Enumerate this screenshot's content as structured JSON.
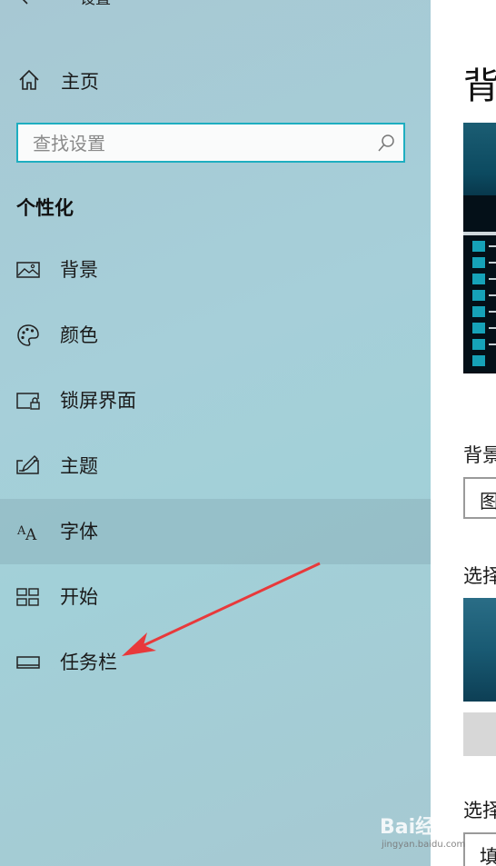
{
  "app": {
    "title": "设置"
  },
  "sidebar": {
    "home_label": "主页",
    "search_placeholder": "查找设置",
    "section_title": "个性化",
    "items": [
      {
        "label": "背景",
        "icon": "picture-icon"
      },
      {
        "label": "颜色",
        "icon": "palette-icon"
      },
      {
        "label": "锁屏界面",
        "icon": "lock-screen-icon"
      },
      {
        "label": "主题",
        "icon": "theme-icon"
      },
      {
        "label": "字体",
        "icon": "font-icon",
        "selected": true
      },
      {
        "label": "开始",
        "icon": "start-icon"
      },
      {
        "label": "任务栏",
        "icon": "taskbar-icon"
      }
    ]
  },
  "content": {
    "page_title": "背",
    "background_label": "背景",
    "background_value": "图",
    "choose_label_1": "选择",
    "choose_label_2": "选择",
    "fit_value": "填"
  },
  "watermark": {
    "text": "Bai经验",
    "sub": "jingyan.baidu.com"
  },
  "colors": {
    "accent": "#1eaec0",
    "annotation_arrow": "#e8393b"
  }
}
